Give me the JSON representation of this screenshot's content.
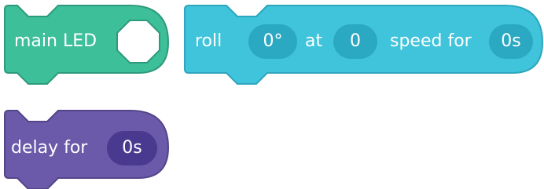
{
  "blocks": {
    "main_led": {
      "label": "main LED",
      "color": "#3dbf9a",
      "border": "#2e9a7c"
    },
    "roll": {
      "label": "roll",
      "heading_value": "0°",
      "at_label": "at",
      "speed_value": "0",
      "speed_label": "speed for",
      "duration_value": "0s",
      "color": "#3fc4db",
      "border": "#2ea6bd",
      "pill_color": "#2ba8c2"
    },
    "delay": {
      "label": "delay for",
      "duration_value": "0s",
      "color": "#6a5aa9",
      "border": "#544589",
      "pill_color": "#4a3a8f"
    }
  }
}
